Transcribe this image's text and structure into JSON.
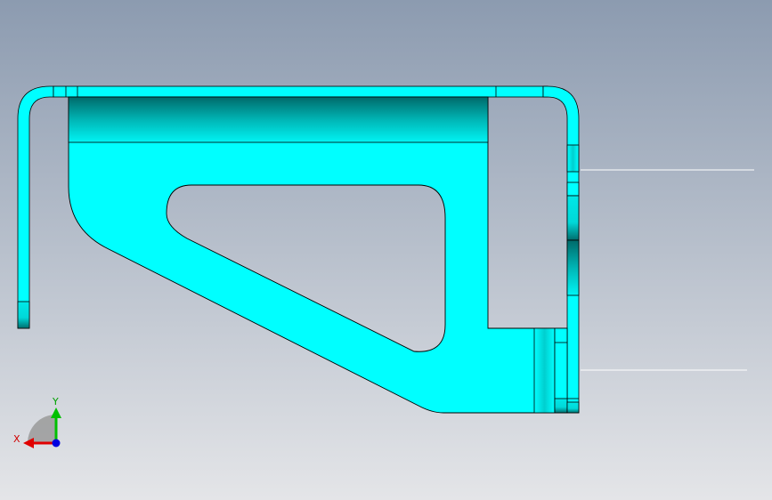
{
  "viewport": {
    "background_top": "#8c9bb0",
    "background_bottom": "#e4e5e8"
  },
  "model": {
    "fill_color": "#00ffff",
    "edge_color": "#000000",
    "shade_color": "#007a7a"
  },
  "triad": {
    "x_label": "X",
    "y_label": "Y",
    "x_color": "#e00000",
    "y_color": "#00c000",
    "z_color": "#0000e0"
  }
}
